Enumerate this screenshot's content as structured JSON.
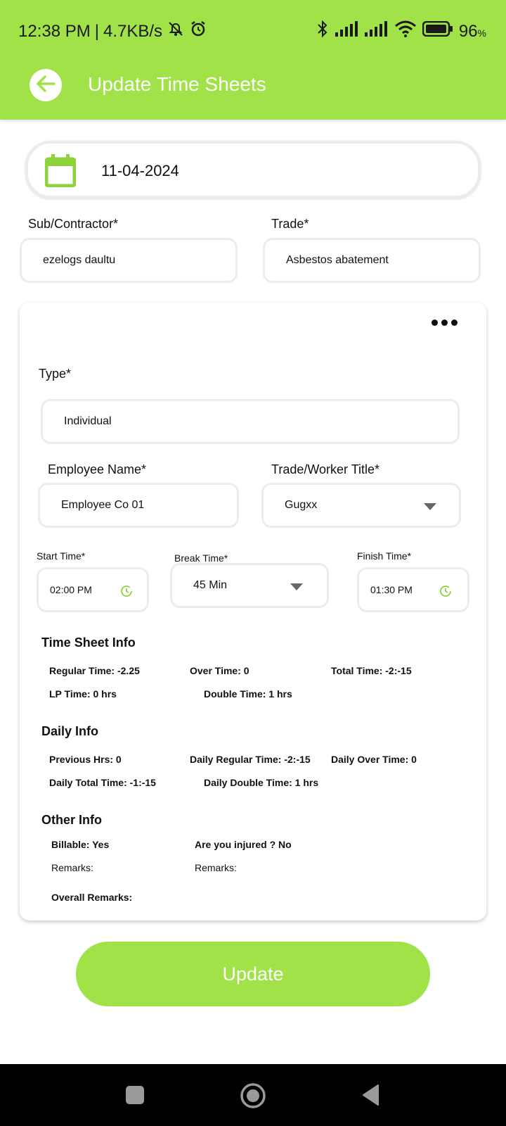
{
  "status": {
    "time": "12:38 PM",
    "speed": "4.7KB/s",
    "battery": "96",
    "battery_unit": "%",
    "icons": [
      "bell-off-icon",
      "alarm-icon",
      "bluetooth-icon",
      "signal-icon",
      "signal-icon",
      "wifi-icon",
      "battery-icon"
    ]
  },
  "header": {
    "title": "Update Time Sheets"
  },
  "date": {
    "value": "11-04-2024"
  },
  "subcontractor": {
    "label": "Sub/Contractor*",
    "value": "ezelogs daultu"
  },
  "trade": {
    "label": "Trade*",
    "value": "Asbestos abatement"
  },
  "card": {
    "type": {
      "label": "Type*",
      "value": "Individual"
    },
    "employee": {
      "label": "Employee Name*",
      "value": "Employee Co 01"
    },
    "worker_title": {
      "label": "Trade/Worker Title*",
      "value": "Gugxx"
    },
    "start_time": {
      "label": "Start Time*",
      "value": "02:00 PM"
    },
    "break_time": {
      "label": "Break Time*",
      "value": "45 Min"
    },
    "finish_time": {
      "label": "Finish Time*",
      "value": "01:30 PM"
    },
    "time_sheet_info": {
      "title": "Time Sheet Info",
      "regular": "Regular Time:  -2.25",
      "over": "Over Time:  0",
      "total": "Total Time:  -2:-15",
      "lp": "LP Time:  0 hrs",
      "double": "Double Time:  1 hrs"
    },
    "daily_info": {
      "title": "Daily Info",
      "previous": "Previous Hrs:  0",
      "daily_regular": "Daily Regular Time:  -2:-15",
      "daily_over": "Daily Over Time:  0",
      "daily_total": "Daily Total Time:  -1:-15",
      "daily_double": "Daily Double Time:  1 hrs"
    },
    "other_info": {
      "title": "Other Info",
      "billable": "Billable:  Yes",
      "injured": "Are you injured ?  No",
      "remarks_left": "Remarks:",
      "remarks_right": "Remarks:",
      "overall_remarks": "Overall Remarks:"
    }
  },
  "update_button": {
    "label": "Update"
  },
  "colors": {
    "accent": "#a0e247",
    "border": "#ebebf3",
    "clock": "#8ed23c"
  }
}
